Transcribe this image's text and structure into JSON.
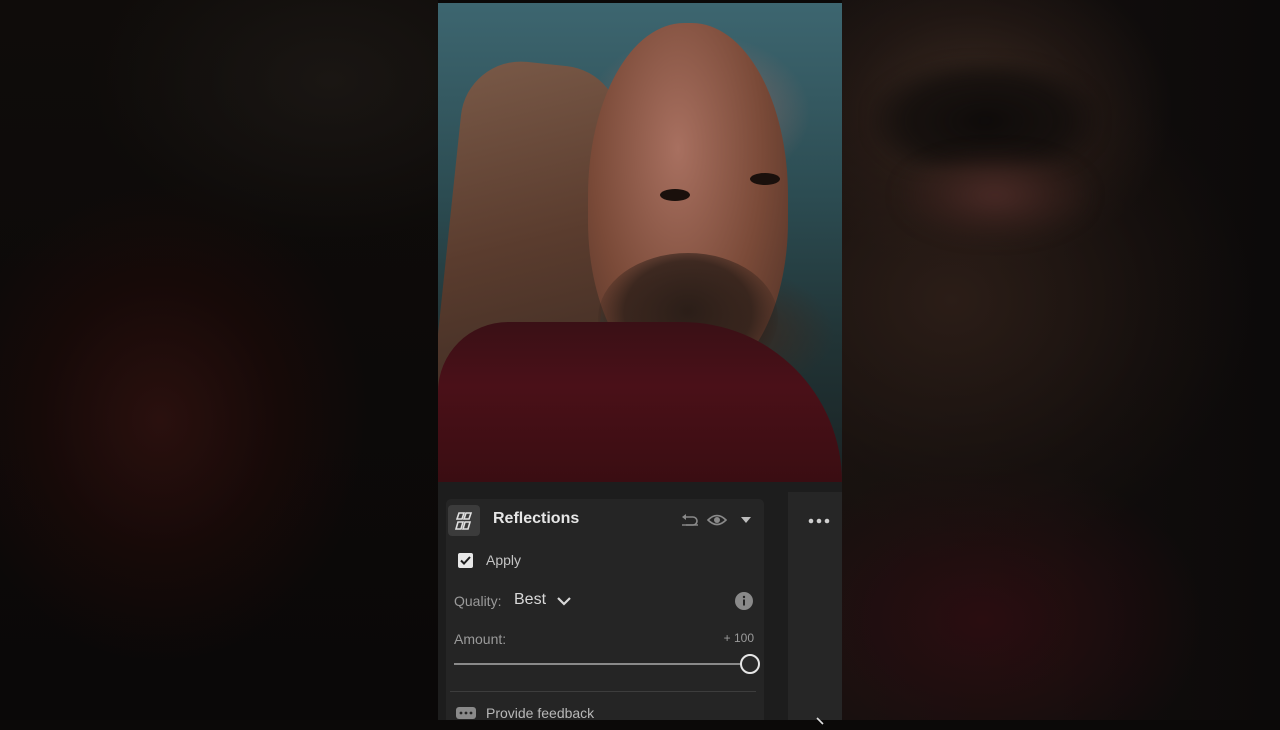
{
  "panel": {
    "title": "Reflections",
    "apply_label": "Apply",
    "apply_checked": true,
    "quality_label": "Quality:",
    "quality_value": "Best",
    "amount_label": "Amount:",
    "amount_value": "+ 100",
    "amount_fraction": 1.0,
    "feedback_label": "Provide feedback"
  },
  "icons": {
    "panel_icon": "reflections-icon",
    "reset": "reset-icon",
    "visibility": "eye-icon",
    "collapse": "chevron-down-icon",
    "quality_dropdown": "chevron-down-icon",
    "info": "info-icon",
    "feedback": "feedback-icon",
    "more": "more-icon"
  },
  "colors": {
    "panel_bg": "#252525",
    "text_primary": "#e6e6e6",
    "text_secondary": "#9a9a9a"
  }
}
